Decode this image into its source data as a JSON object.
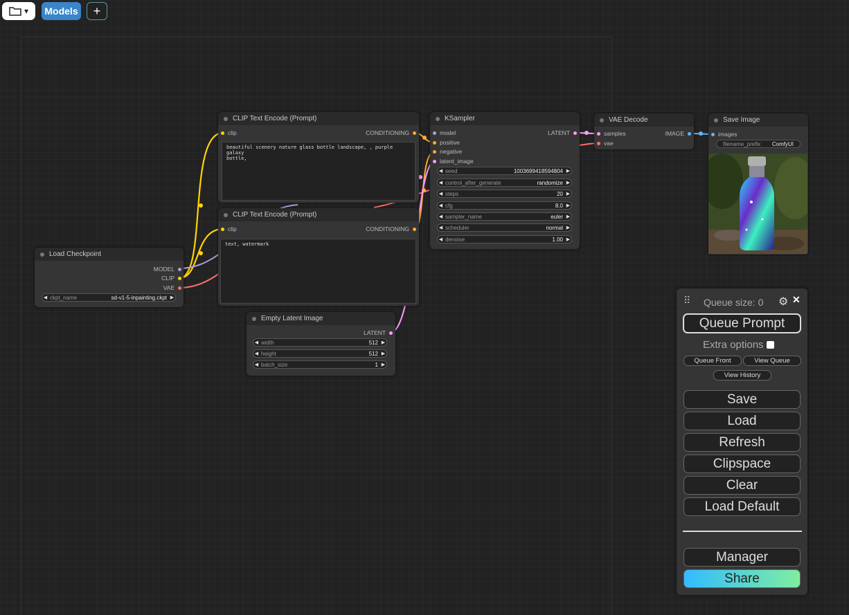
{
  "toolbar": {
    "folder_caret": "▾",
    "models_label": "Models",
    "add_label": "+"
  },
  "nodes": {
    "load_checkpoint": {
      "title": "Load Checkpoint",
      "outputs": [
        "MODEL",
        "CLIP",
        "VAE"
      ],
      "ckpt_label": "ckpt_name",
      "ckpt_value": "sd-v1-5-inpainting.ckpt"
    },
    "clip_pos": {
      "title": "CLIP Text Encode (Prompt)",
      "input": "clip",
      "output": "CONDITIONING",
      "text": "beautiful scenery nature glass bottle landscape, , purple galaxy\nbottle,"
    },
    "clip_neg": {
      "title": "CLIP Text Encode (Prompt)",
      "input": "clip",
      "output": "CONDITIONING",
      "text": "text, watermark"
    },
    "empty_latent": {
      "title": "Empty Latent Image",
      "output": "LATENT",
      "widgets": [
        {
          "label": "width",
          "value": "512"
        },
        {
          "label": "height",
          "value": "512"
        },
        {
          "label": "batch_size",
          "value": "1"
        }
      ]
    },
    "ksampler": {
      "title": "KSampler",
      "inputs": [
        "model",
        "positive",
        "negative",
        "latent_image"
      ],
      "output": "LATENT",
      "widgets": [
        {
          "label": "seed",
          "value": "1003699418594804"
        },
        {
          "label": "control_after_generate",
          "value": "randomize"
        },
        {
          "label": "steps",
          "value": "20"
        },
        {
          "label": "cfg",
          "value": "8.0"
        },
        {
          "label": "sampler_name",
          "value": "euler"
        },
        {
          "label": "scheduler",
          "value": "normal"
        },
        {
          "label": "denoise",
          "value": "1.00"
        }
      ]
    },
    "vae_decode": {
      "title": "VAE Decode",
      "inputs": [
        "samples",
        "vae"
      ],
      "output": "IMAGE"
    },
    "save_image": {
      "title": "Save Image",
      "input": "images",
      "prefix_label": "filename_prefix",
      "prefix_value": "ComfyUI"
    }
  },
  "queue_panel": {
    "drag_handle": "⠿",
    "queue_size_label": "Queue size: 0",
    "settings_icon": "⚙",
    "close_icon": "✕",
    "queue_prompt": "Queue Prompt",
    "extra_options": "Extra options",
    "queue_front": "Queue Front",
    "view_queue": "View Queue",
    "view_history": "View History",
    "buttons": [
      "Save",
      "Load",
      "Refresh",
      "Clipspace",
      "Clear",
      "Load Default"
    ],
    "manager": "Manager",
    "share": "Share"
  },
  "colors": {
    "clip_link": "#ffd500",
    "model_link": "#b39ddb",
    "vae_link": "#ff6e6e",
    "conditioning_link": "#ffa931",
    "latent_link": "#ff9cf9",
    "image_link": "#64b5f6",
    "models_button": "#3a86c8"
  }
}
